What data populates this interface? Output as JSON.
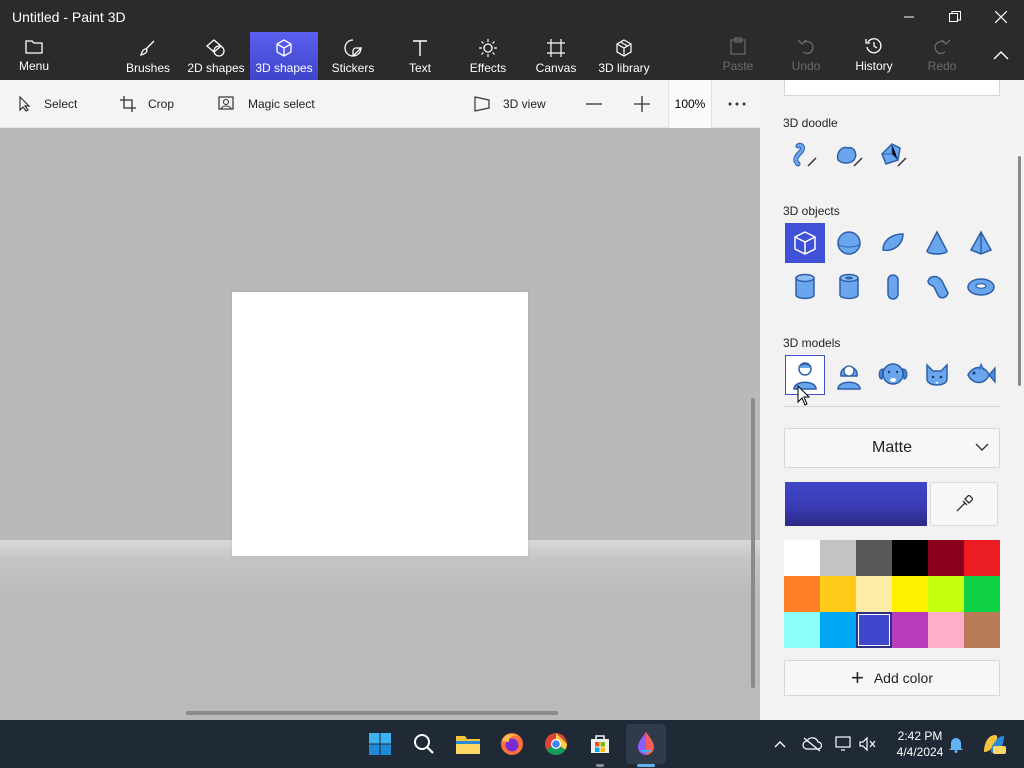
{
  "window": {
    "title": "Untitled - Paint 3D"
  },
  "ribbon": {
    "menu": "Menu",
    "brushes": "Brushes",
    "shapes_2d": "2D shapes",
    "shapes_3d": "3D shapes",
    "stickers": "Stickers",
    "text": "Text",
    "effects": "Effects",
    "canvas": "Canvas",
    "library_3d": "3D library",
    "paste": "Paste",
    "undo": "Undo",
    "history": "History",
    "redo": "Redo",
    "active_tab": "3D shapes"
  },
  "toolbar": {
    "select": "Select",
    "crop": "Crop",
    "magic_select": "Magic select",
    "view_3d": "3D view",
    "zoom": "100%"
  },
  "panel": {
    "doodle_title": "3D doodle",
    "objects_title": "3D objects",
    "models_title": "3D models",
    "doodle_items": [
      "sharp-edge-doodle-icon",
      "soft-edge-doodle-icon",
      "tube-doodle-icon"
    ],
    "object_items": [
      "cube-icon",
      "sphere-icon",
      "hemisphere-icon",
      "cone-icon",
      "pyramid-icon",
      "cylinder-icon",
      "tube-icon",
      "capsule-icon",
      "curved-cylinder-icon",
      "donut-icon"
    ],
    "model_items": [
      "man-icon",
      "woman-icon",
      "dog-icon",
      "cat-icon",
      "fish-icon"
    ],
    "selected_object": "cube-icon",
    "material": "Matte",
    "current_color": "#3f45c9",
    "add_color": "Add color",
    "palette": [
      "#ffffff",
      "#c3c3c3",
      "#585858",
      "#000000",
      "#88001b",
      "#ec1c24",
      "#ff7f27",
      "#ffca18",
      "#fdeca6",
      "#fff200",
      "#c4ff0e",
      "#0ed145",
      "#8cfffb",
      "#00a8f3",
      "#3f48cc",
      "#b83dba",
      "#ffaec8",
      "#b97a56"
    ],
    "selected_swatch": "#3f48cc"
  },
  "taskbar": {
    "time": "2:42 PM",
    "date": "4/4/2024",
    "apps": [
      "windows-start-icon",
      "search-icon",
      "file-explorer-icon",
      "firefox-icon",
      "chrome-icon",
      "microsoft-store-icon",
      "paint-3d-icon"
    ]
  }
}
